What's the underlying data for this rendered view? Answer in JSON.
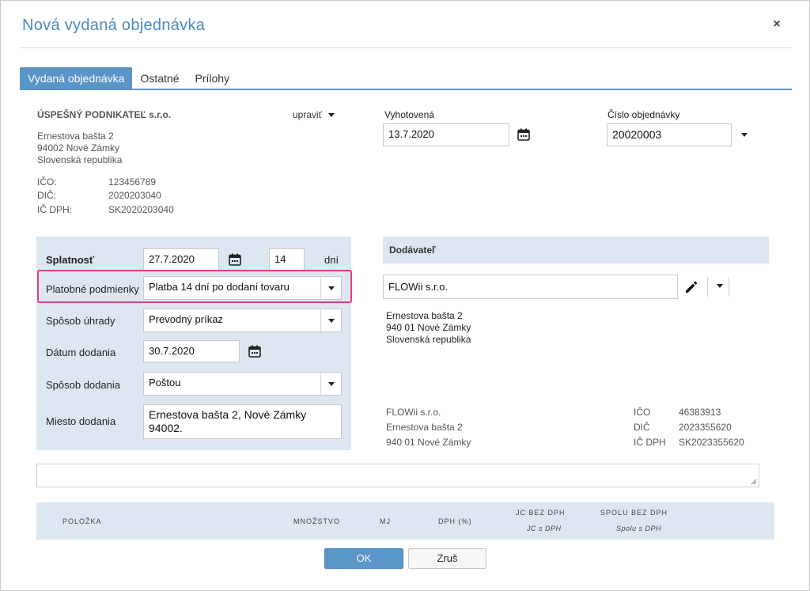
{
  "dialog": {
    "title": "Nová vydaná objednávka",
    "close": "×"
  },
  "tabs": [
    {
      "label": "Vydaná objednávka"
    },
    {
      "label": "Ostatné"
    },
    {
      "label": "Prílohy"
    }
  ],
  "company": {
    "name": "ÚSPEŠNÝ PODNIKATEĽ s.r.o.",
    "edit_label": "upraviť",
    "address": [
      "Ernestova bašta 2",
      "94002 Nové Zámky",
      "Slovenská republika"
    ],
    "ico_label": "IČO:",
    "ico": "123456789",
    "dic_label": "DIČ:",
    "dic": "2020203040",
    "icdph_label": "IČ DPH:",
    "icdph": "SK2020203040"
  },
  "issued": {
    "label": "Vyhotovená",
    "value": "13.7.2020"
  },
  "order_number": {
    "label": "Číslo objednávky",
    "value": "20020003"
  },
  "form": {
    "due": {
      "label": "Splatnosť",
      "date": "27.7.2020",
      "days": "14",
      "days_unit": "dní"
    },
    "payment_terms": {
      "label": "Platobné podmienky",
      "value": "Platba 14 dní po dodaní tovaru"
    },
    "payment_method": {
      "label": "Spôsob úhrady",
      "value": "Prevodný príkaz"
    },
    "delivery_date": {
      "label": "Dátum dodania",
      "value": "30.7.2020"
    },
    "delivery_method": {
      "label": "Spôsob dodania",
      "value": "Poštou"
    },
    "delivery_place": {
      "label": "Miesto dodania",
      "line1": "Ernestova bašta 2, Nové Zámky",
      "line2": "94002."
    }
  },
  "supplier": {
    "header": "Dodávateľ",
    "name": "FLOWii s.r.o.",
    "address": [
      "Ernestova bašta 2",
      "940 01 Nové Zámky",
      "Slovenská republika"
    ],
    "footer_lines": [
      "FLOWii s.r.o.",
      "Ernestova bašta 2",
      "940 01 Nové Zámky"
    ],
    "ico_label": "IČO",
    "ico": "46383913",
    "dic_label": "DIČ",
    "dic": "2023355620",
    "icdph_label": "IČ DPH",
    "icdph": "SK2023355620"
  },
  "table": {
    "item": "POLOŽKA",
    "quantity": "MNOŽSTVO",
    "unit": "MJ",
    "vat": "DPH (%)",
    "unit_price_excl": "JC BEZ DPH",
    "unit_price_incl": "JC s DPH",
    "total_excl": "SPOLU BEZ DPH",
    "total_incl": "Spolu s DPH"
  },
  "buttons": {
    "ok": "OK",
    "cancel": "Zruš"
  },
  "colors": {
    "accent": "#5a95c8",
    "panel": "#dde7f1",
    "highlight": "#e0407a",
    "title": "#4a8bc2"
  }
}
